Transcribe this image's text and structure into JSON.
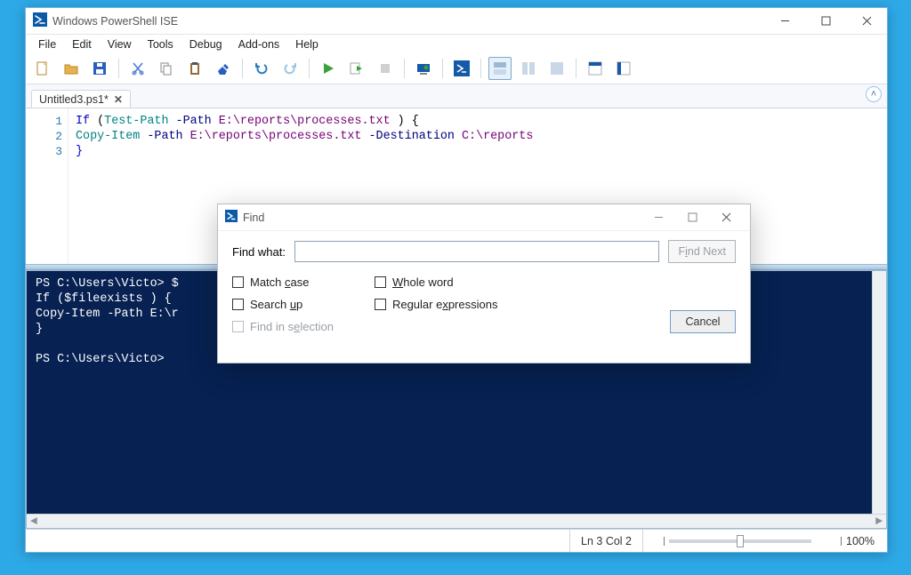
{
  "window": {
    "title": "Windows PowerShell ISE"
  },
  "menubar": [
    "File",
    "Edit",
    "View",
    "Tools",
    "Debug",
    "Add-ons",
    "Help"
  ],
  "tab": {
    "label": "Untitled3.ps1*"
  },
  "code": {
    "lines": [
      "1",
      "2",
      "3"
    ],
    "l1_if": "If",
    "l1_open": " (",
    "l1_cmd": "Test-Path",
    "l1_sp": " ",
    "l1_param": "-Path",
    "l1_sp2": " ",
    "l1_path": "E:\\reports\\processes.txt",
    "l1_close": " ) {",
    "l2_cmd": "Copy-Item",
    "l2_sp": " ",
    "l2_p1": "-Path",
    "l2_sp2": " ",
    "l2_path1": "E:\\reports\\processes.txt",
    "l2_sp3": " ",
    "l2_p2": "-Destination",
    "l2_sp4": " ",
    "l2_path2": "C:\\reports",
    "l3": "}"
  },
  "console": {
    "line1a": "PS C:\\Users\\Victo> ",
    "line1b": "$",
    "line2": "If ($fileexists ) {",
    "line3": "Copy-Item -Path E:\\r",
    "line4": "}",
    "line_blank": "",
    "line5": "PS C:\\Users\\Victo>"
  },
  "find": {
    "title": "Find",
    "label_findwhat": "Find what:",
    "btn_findnext_pre": "F",
    "btn_findnext_u": "i",
    "btn_findnext_post": "nd Next",
    "chk_match_pre": "Match ",
    "chk_match_u": "c",
    "chk_match_post": "ase",
    "chk_whole_u": "W",
    "chk_whole_post": "hole word",
    "chk_up_pre": "Search ",
    "chk_up_u": "u",
    "chk_up_post": "p",
    "chk_regex_pre": "Regular e",
    "chk_regex_u": "x",
    "chk_regex_post": "pressions",
    "chk_sel_pre": "Find in s",
    "chk_sel_u": "e",
    "chk_sel_post": "lection",
    "btn_cancel": "Cancel"
  },
  "status": {
    "pos": "Ln 3  Col 2",
    "zoom": "100%"
  }
}
